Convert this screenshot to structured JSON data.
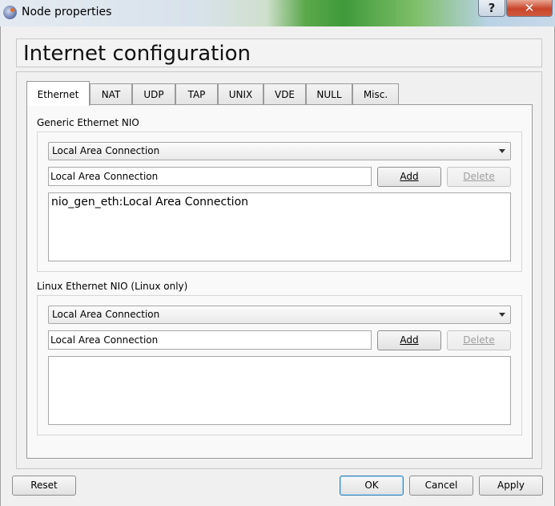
{
  "window": {
    "title": "Node properties",
    "help_label": "?",
    "close_label": "✕"
  },
  "page_title": "Internet configuration",
  "tabs": [
    {
      "label": "Ethernet",
      "active": true
    },
    {
      "label": "NAT"
    },
    {
      "label": "UDP"
    },
    {
      "label": "TAP"
    },
    {
      "label": "UNIX"
    },
    {
      "label": "VDE"
    },
    {
      "label": "NULL"
    },
    {
      "label": "Misc."
    }
  ],
  "generic": {
    "label": "Generic Ethernet NIO",
    "combo_value": "Local Area Connection",
    "input_value": "Local Area Connection",
    "add_label": "Add",
    "delete_label": "Delete",
    "list_items": [
      "nio_gen_eth:Local Area Connection"
    ]
  },
  "linux": {
    "label": "Linux Ethernet NIO (Linux only)",
    "combo_value": "Local Area Connection",
    "input_value": "Local Area Connection",
    "add_label": "Add",
    "delete_label": "Delete",
    "list_items": []
  },
  "footer": {
    "reset_label": "Reset",
    "ok_label": "OK",
    "cancel_label": "Cancel",
    "apply_label": "Apply"
  }
}
